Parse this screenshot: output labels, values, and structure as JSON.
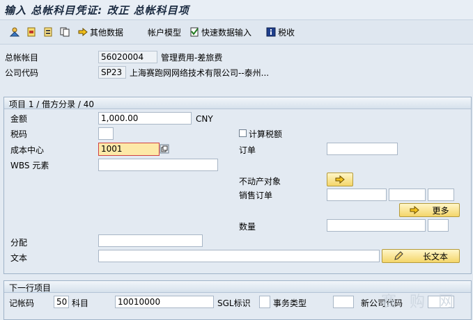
{
  "title": "输入 总帐科目凭证: 改正 总帐科目项",
  "toolbar": {
    "other_data": "其他数据",
    "account_model": "帐户模型",
    "fast_entry": "快速数据输入",
    "tax": "税收"
  },
  "header": {
    "gl_account_label": "总帐帐目",
    "gl_account_value": "56020004",
    "gl_account_desc": "管理费用-差旅费",
    "company_code_label": "公司代码",
    "company_code_value": "SP23",
    "company_code_desc": "上海赛跑网网络技术有限公司--泰州..."
  },
  "item_panel": {
    "heading": "项目 1 / 借方分录 / 40",
    "amount_label": "金额",
    "amount_value": "1,000.00",
    "currency": "CNY",
    "tax_code_label": "税码",
    "tax_code_value": "",
    "calc_tax_label": "计算税额",
    "cost_center_label": "成本中心",
    "cost_center_value": "1001",
    "order_label": "订单",
    "order_value": "",
    "wbs_label": "WBS 元素",
    "wbs_value": "",
    "real_estate_label": "不动产对象",
    "sales_order_label": "销售订单",
    "more_label": "更多",
    "quantity_label": "数量",
    "assignment_label": "分配",
    "assignment_value": "",
    "text_label": "文本",
    "text_value": "",
    "long_text_label": "长文本"
  },
  "next_panel": {
    "heading": "下一行项目",
    "posting_key_label": "记帐码",
    "posting_key_value": "50",
    "account_label": "科目",
    "account_value": "10010000",
    "sgl_label": "SGL标识",
    "txn_type_label": "事务类型",
    "new_company_label": "新公司代码"
  },
  "watermark": "赛 购 网",
  "colors": {
    "focus_bg": "#fde9a8",
    "focus_border": "#d04040",
    "button": "#f4d66a"
  }
}
